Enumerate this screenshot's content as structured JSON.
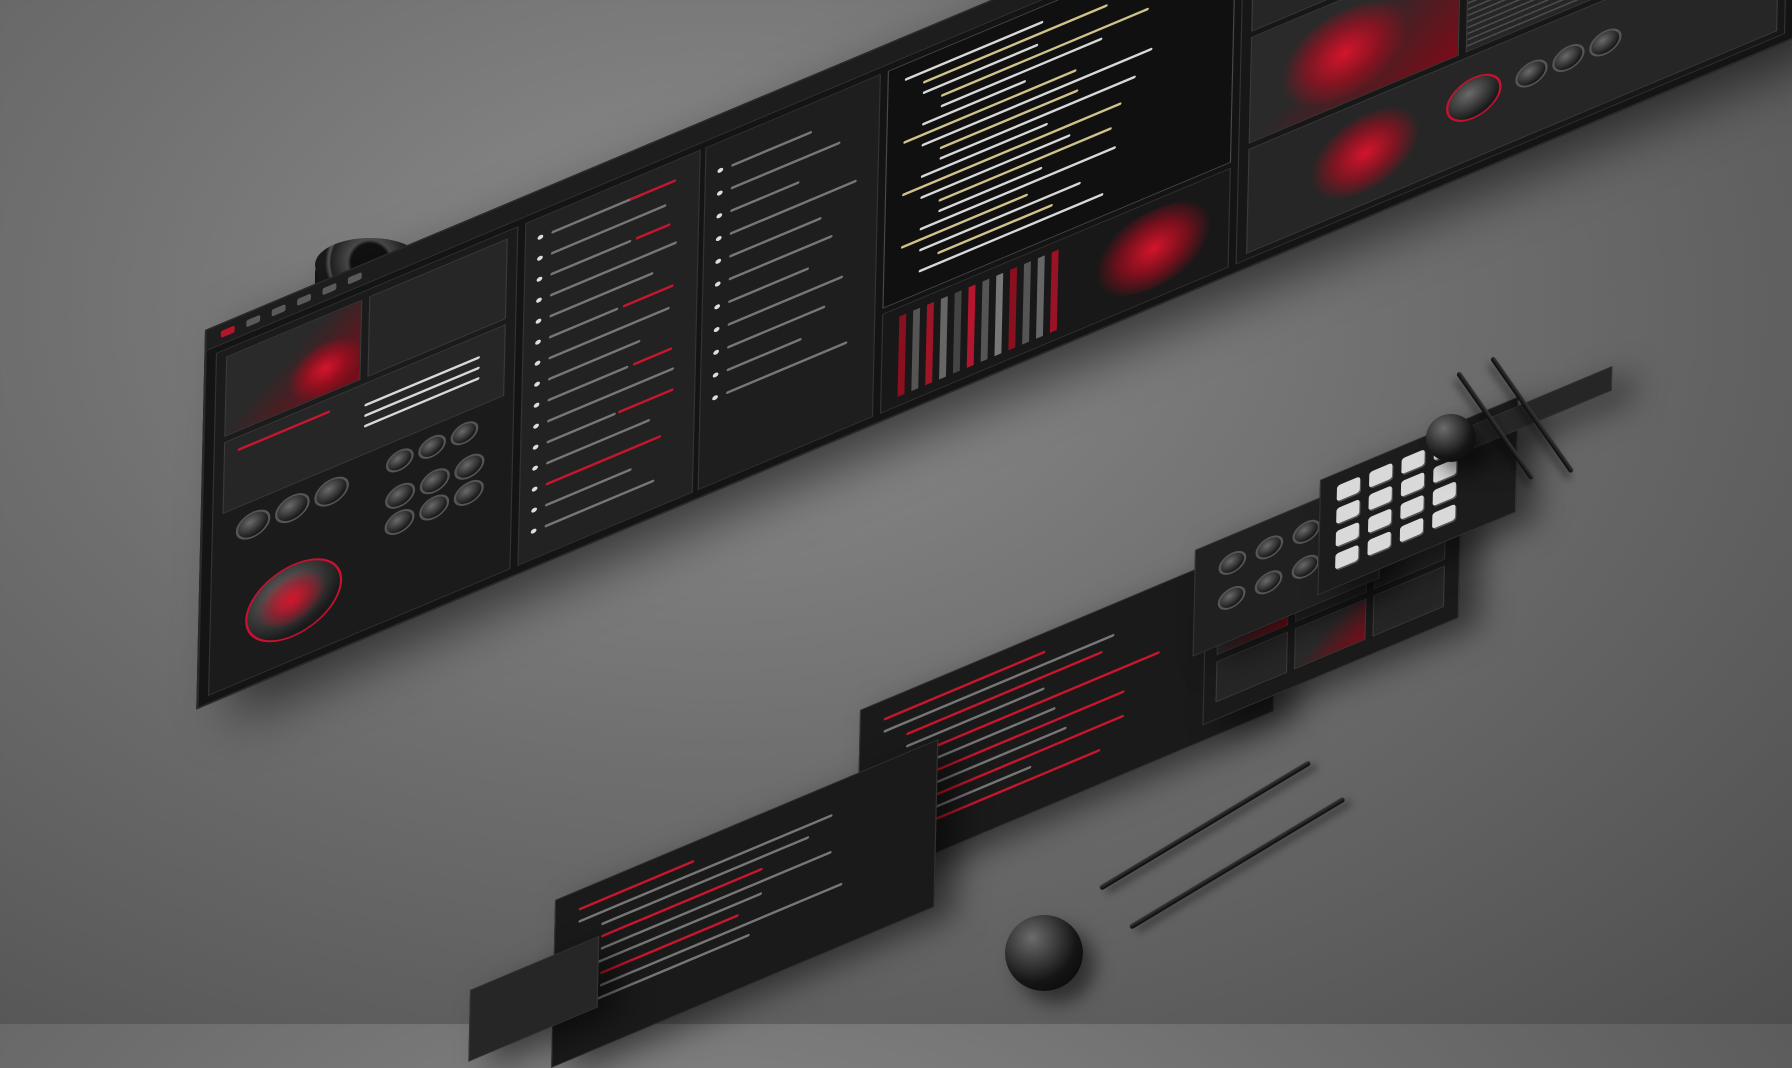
{
  "palette": {
    "background": "#6f6f6f",
    "panel": "#141414",
    "accent_red": "#c8162e",
    "code_white": "#d8d8d8",
    "code_yellow": "#cfc38a"
  },
  "icons": [
    "knob-icon",
    "bullet-icon",
    "key-icon"
  ],
  "objects": [
    "lens-cylinder",
    "ring",
    "sphere",
    "pen",
    "keypad"
  ]
}
